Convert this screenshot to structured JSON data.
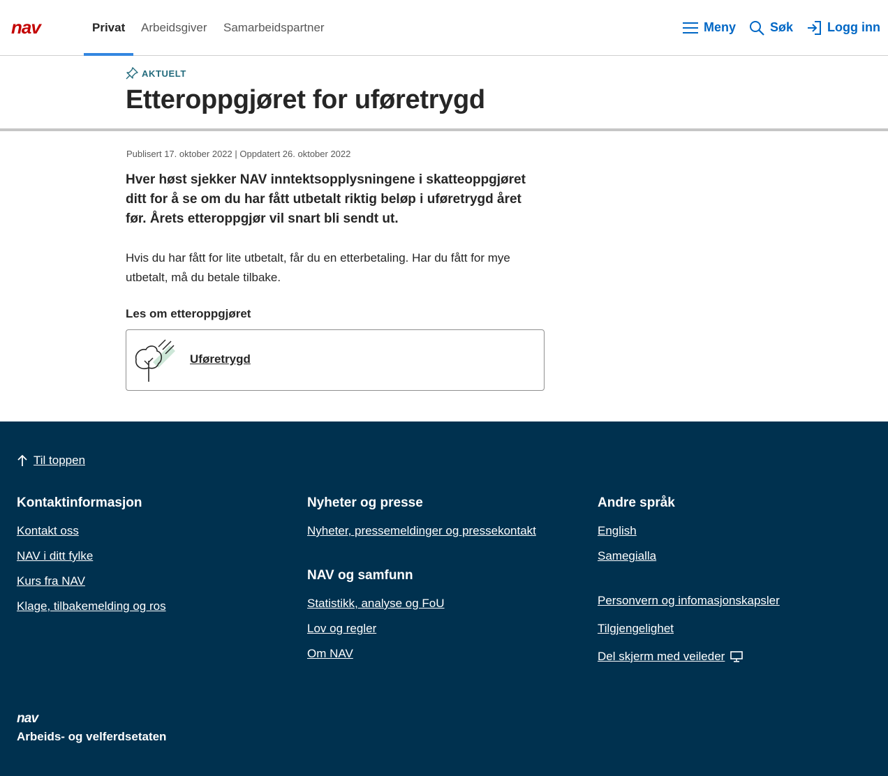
{
  "header": {
    "logo_text": "nav",
    "tabs": [
      {
        "label": "Privat",
        "active": true
      },
      {
        "label": "Arbeidsgiver",
        "active": false
      },
      {
        "label": "Samarbeidspartner",
        "active": false
      }
    ],
    "menu_label": "Meny",
    "search_label": "Søk",
    "login_label": "Logg inn",
    "menu_icon": "hamburger-icon",
    "search_icon": "search-icon",
    "login_icon": "login-icon"
  },
  "article": {
    "tag": "AKTUELT",
    "tag_icon": "pushpin-icon",
    "title": "Etteroppgjøret for uføretrygd",
    "meta": "Publisert 17. oktober 2022 | Oppdatert 26. oktober 2022",
    "ingress": "Hver høst sjekker NAV inntektsopplysningene i skatteoppgjøret ditt for å se om du har fått utbetalt riktig beløp i uføretrygd året før. Årets etteroppgjør vil snart bli sendt ut.",
    "body": "Hvis du har fått for lite utbetalt, får du en etterbetaling. Har du fått for mye utbetalt, må du betale tilbake.",
    "section_label": "Les om etteroppgjøret",
    "card_label": "Uføretrygd",
    "card_icon": "tree-illustration-icon"
  },
  "footer": {
    "to_top": "Til toppen",
    "col1": {
      "heading": "Kontaktinformasjon",
      "links": [
        "Kontakt oss",
        "NAV i ditt fylke",
        "Kurs fra NAV",
        "Klage, tilbakemelding og ros"
      ]
    },
    "col2": {
      "heading": "Nyheter og presse",
      "links": [
        "Nyheter, pressemeldinger og pressekontakt"
      ],
      "heading2": "NAV og samfunn",
      "links2": [
        "Statistikk, analyse og FoU",
        "Lov og regler",
        "Om NAV"
      ]
    },
    "col3": {
      "heading": "Andre språk",
      "links": [
        "English",
        "Samegialla"
      ],
      "links2": [
        "Personvern og infomasjonskapsler",
        "Tilgjengelighet",
        "Del skjerm med veileder"
      ]
    },
    "logo_text": "nav",
    "org_name": "Arbeids- og velferdsetaten"
  },
  "colors": {
    "brand_red": "#c30000",
    "link_blue": "#0067c5",
    "footer_bg": "#00314f",
    "tag_teal": "#236b7d"
  }
}
